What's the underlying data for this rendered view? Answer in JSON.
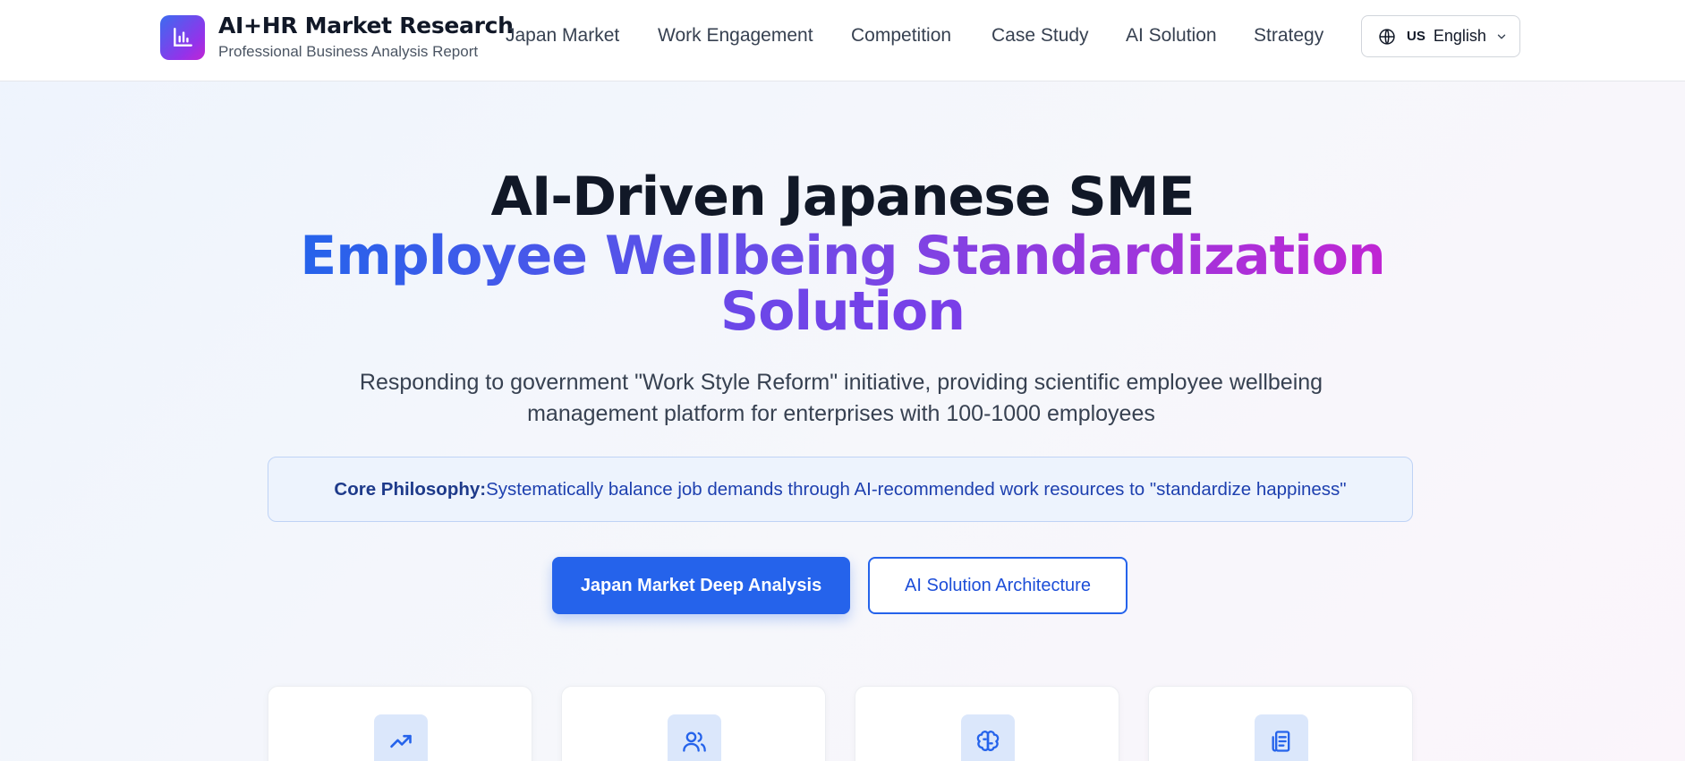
{
  "header": {
    "title": "AI+HR Market Research",
    "subtitle": "Professional Business Analysis Report",
    "logo_icon": "bar-chart-icon"
  },
  "nav": {
    "items": [
      {
        "label": "Japan Market"
      },
      {
        "label": "Work Engagement"
      },
      {
        "label": "Competition"
      },
      {
        "label": "Case Study"
      },
      {
        "label": "AI Solution"
      },
      {
        "label": "Strategy"
      }
    ]
  },
  "language": {
    "flag": "US",
    "label": "English",
    "icon": "globe-icon"
  },
  "hero": {
    "title_line1": "AI-Driven Japanese SME",
    "title_line2a": "Employee Wellbeing Standardization",
    "title_line2b": "Solution",
    "description": "Responding to government \"Work Style Reform\" initiative, providing scientific employee wellbeing management platform for enterprises with 100-1000 employees",
    "philosophy_label": "Core Philosophy:",
    "philosophy_text": "Systematically balance job demands through AI-recommended work resources to \"standardize happiness\"",
    "primary_button": "Japan Market Deep Analysis",
    "secondary_button": "AI Solution Architecture"
  },
  "cards": [
    {
      "icon": "trending-up-icon"
    },
    {
      "icon": "users-icon"
    },
    {
      "icon": "brain-icon"
    },
    {
      "icon": "document-icon"
    }
  ],
  "colors": {
    "primary": "#2563eb",
    "gradient_start": "#2563eb",
    "gradient_mid": "#6d4be8",
    "gradient_end": "#c026d3",
    "philosophy_bg": "#edf3fd",
    "card_icon_bg": "#dbe7fb"
  }
}
